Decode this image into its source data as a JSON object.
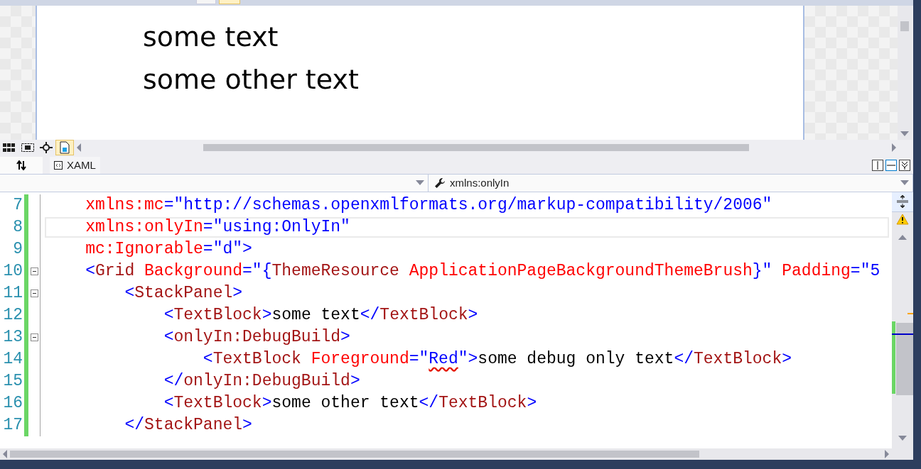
{
  "designer": {
    "lines": [
      "some text",
      "some other text"
    ]
  },
  "designer_toolbar": {
    "buttons": [
      {
        "kind": "grid",
        "selected": false
      },
      {
        "kind": "effects",
        "selected": false
      },
      {
        "kind": "snap",
        "selected": false
      },
      {
        "kind": "document",
        "selected": true
      }
    ]
  },
  "tabs": [
    {
      "label": "XAML"
    }
  ],
  "pane_buttons": [
    {
      "kind": "vertical",
      "selected": false
    },
    {
      "kind": "horizontal",
      "selected": true
    },
    {
      "kind": "collapse",
      "selected": false
    }
  ],
  "nav_bar": {
    "member": "xmlns:onlyIn"
  },
  "editor": {
    "lines": [
      {
        "number": "7",
        "current": false,
        "changed": true,
        "fold": false,
        "tokens": [
          {
            "kind": "attr",
            "text": "    xmlns:mc"
          },
          {
            "kind": "value",
            "text": "=\"http://schemas.openxmlformats.org/markup-compatibility/2006\""
          }
        ]
      },
      {
        "number": "8",
        "current": true,
        "changed": true,
        "fold": false,
        "tokens": [
          {
            "kind": "attr",
            "text": "    xmlns:onlyIn"
          },
          {
            "kind": "value",
            "text": "=\"using:OnlyIn\""
          }
        ]
      },
      {
        "number": "9",
        "current": false,
        "changed": true,
        "fold": false,
        "tokens": [
          {
            "kind": "attr",
            "text": "    mc:Ignorable"
          },
          {
            "kind": "value",
            "text": "=\"d\">"
          }
        ]
      },
      {
        "number": "10",
        "current": false,
        "changed": true,
        "fold": true,
        "tokens": [
          {
            "kind": "punct",
            "text": "    <"
          },
          {
            "kind": "element",
            "text": "Grid"
          },
          {
            "kind": "attr",
            "text": " Background"
          },
          {
            "kind": "value",
            "text": "=\"{"
          },
          {
            "kind": "element",
            "text": "ThemeResource"
          },
          {
            "kind": "attr",
            "text": " ApplicationPageBackgroundThemeBrush"
          },
          {
            "kind": "value",
            "text": "}\""
          },
          {
            "kind": "attr",
            "text": " Padding"
          },
          {
            "kind": "value",
            "text": "=\"5"
          }
        ]
      },
      {
        "number": "11",
        "current": false,
        "changed": true,
        "fold": true,
        "tokens": [
          {
            "kind": "punct",
            "text": "        <"
          },
          {
            "kind": "element",
            "text": "StackPanel"
          },
          {
            "kind": "punct",
            "text": ">"
          }
        ]
      },
      {
        "number": "12",
        "current": false,
        "changed": true,
        "fold": false,
        "tokens": [
          {
            "kind": "punct",
            "text": "            <"
          },
          {
            "kind": "element",
            "text": "TextBlock"
          },
          {
            "kind": "punct",
            "text": ">"
          },
          {
            "kind": "text",
            "text": "some text"
          },
          {
            "kind": "punct",
            "text": "</"
          },
          {
            "kind": "element",
            "text": "TextBlock"
          },
          {
            "kind": "punct",
            "text": ">"
          }
        ]
      },
      {
        "number": "13",
        "current": false,
        "changed": true,
        "fold": true,
        "tokens": [
          {
            "kind": "punct",
            "text": "            <"
          },
          {
            "kind": "element",
            "text": "onlyIn:DebugBuild"
          },
          {
            "kind": "punct",
            "text": ">"
          }
        ]
      },
      {
        "number": "14",
        "current": false,
        "changed": true,
        "fold": false,
        "tokens": [
          {
            "kind": "punct",
            "text": "                <"
          },
          {
            "kind": "element",
            "text": "TextBlock"
          },
          {
            "kind": "attr",
            "text": " Foreground"
          },
          {
            "kind": "value",
            "text": "=\""
          },
          {
            "kind": "value",
            "text": "Red",
            "error": true
          },
          {
            "kind": "value",
            "text": "\">"
          },
          {
            "kind": "text",
            "text": "some debug only text"
          },
          {
            "kind": "punct",
            "text": "</"
          },
          {
            "kind": "element",
            "text": "TextBlock"
          },
          {
            "kind": "punct",
            "text": ">"
          }
        ]
      },
      {
        "number": "15",
        "current": false,
        "changed": true,
        "fold": false,
        "tokens": [
          {
            "kind": "punct",
            "text": "            </"
          },
          {
            "kind": "element",
            "text": "onlyIn:DebugBuild"
          },
          {
            "kind": "punct",
            "text": ">"
          }
        ]
      },
      {
        "number": "16",
        "current": false,
        "changed": true,
        "fold": false,
        "tokens": [
          {
            "kind": "punct",
            "text": "            <"
          },
          {
            "kind": "element",
            "text": "TextBlock"
          },
          {
            "kind": "punct",
            "text": ">"
          },
          {
            "kind": "text",
            "text": "some other text"
          },
          {
            "kind": "punct",
            "text": "</"
          },
          {
            "kind": "element",
            "text": "TextBlock"
          },
          {
            "kind": "punct",
            "text": ">"
          }
        ]
      },
      {
        "number": "17",
        "current": false,
        "changed": true,
        "fold": false,
        "tokens": [
          {
            "kind": "punct",
            "text": "        </"
          },
          {
            "kind": "element",
            "text": "StackPanel"
          },
          {
            "kind": "punct",
            "text": ">"
          }
        ]
      }
    ]
  }
}
